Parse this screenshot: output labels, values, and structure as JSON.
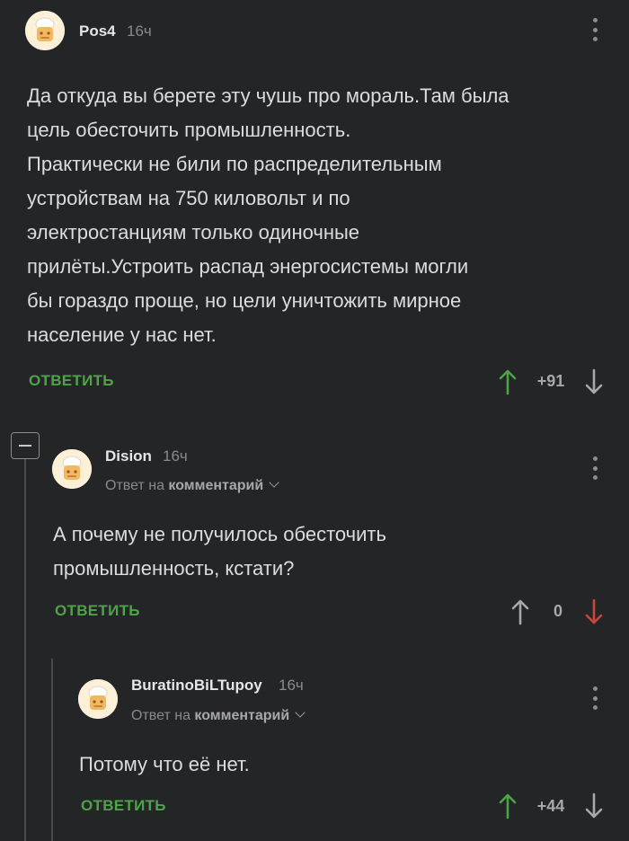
{
  "comments": [
    {
      "username": "Pos4",
      "time": "16ч",
      "lines": [
        "Да откуда вы берете эту чушь про мораль.Там была",
        "цель обесточить промышленность.",
        "Практически не били по распределительным",
        "устройствам на 750 киловольт и по",
        "электростанциям только одиночные",
        "прилёты.Устроить распад энергосистемы могли",
        "бы гораздо проще, но цели уничтожить мирное",
        "население у нас нет."
      ],
      "reply_label": "ОТВЕТИТЬ",
      "score": "+91",
      "vote_state": "up"
    },
    {
      "username": "Dision",
      "time": "16ч",
      "reply_to_prefix": "Ответ на",
      "reply_to_target": "комментарий",
      "lines": [
        "А почему не получилось обесточить",
        "промышленность, кстати?"
      ],
      "reply_label": "ОТВЕТИТЬ",
      "score": "0",
      "vote_state": "down"
    },
    {
      "username": "BuratinoBiLTupoy",
      "time": "16ч",
      "reply_to_prefix": "Ответ на",
      "reply_to_target": "комментарий",
      "lines": [
        "Потому что её нет."
      ],
      "reply_label": "ОТВЕТИТЬ",
      "score": "+44",
      "vote_state": "up"
    }
  ],
  "colors": {
    "background": "#242527",
    "accent_green": "#4ea248",
    "downvote_red": "#c8463e",
    "muted": "#8a8a8a"
  },
  "icons": [
    "avatar-icon",
    "kebab-menu-icon",
    "upvote-arrow-icon",
    "downvote-arrow-icon",
    "chevron-down-icon",
    "collapse-minus-icon"
  ]
}
